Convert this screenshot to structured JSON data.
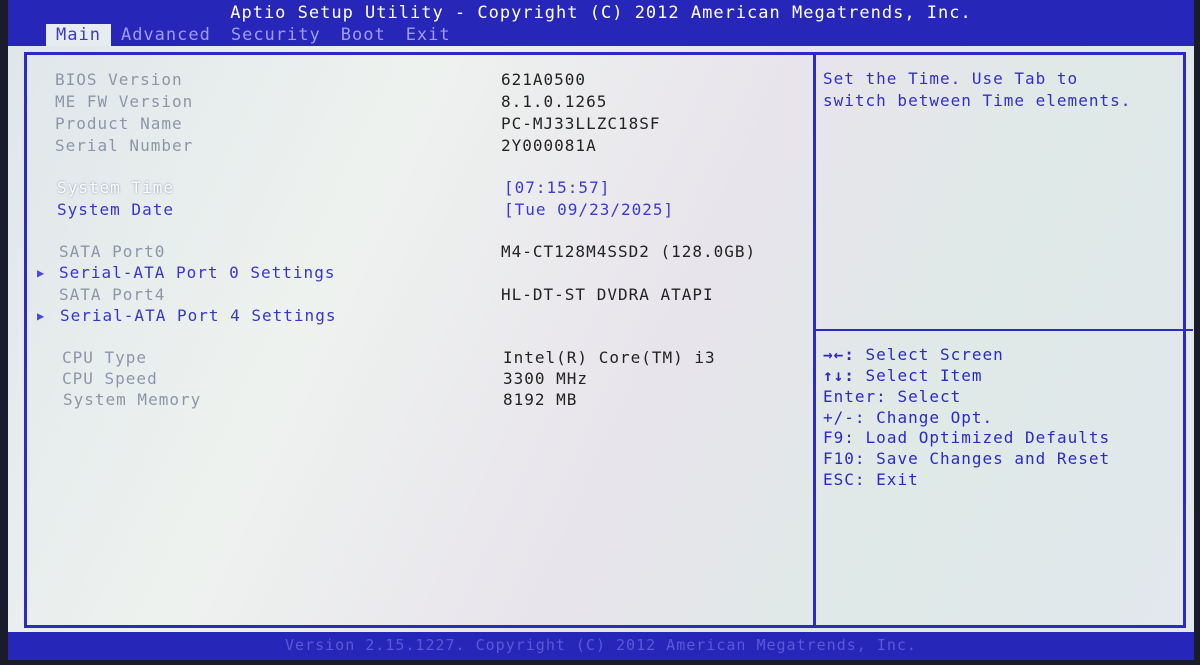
{
  "header": {
    "title": "Aptio Setup Utility - Copyright (C) 2012 American Megatrends, Inc.",
    "tabs": [
      {
        "label": "Main"
      },
      {
        "label": "Advanced"
      },
      {
        "label": "Security"
      },
      {
        "label": "Boot"
      },
      {
        "label": "Exit"
      }
    ]
  },
  "info": {
    "bios_version": {
      "label": "BIOS Version",
      "value": "621A0500"
    },
    "me_fw_version": {
      "label": "ME FW Version",
      "value": "8.1.0.1265"
    },
    "product_name": {
      "label": "Product Name",
      "value": "PC-MJ33LLZC18SF"
    },
    "serial_number": {
      "label": "Serial Number",
      "value": "2Y000081A"
    }
  },
  "time": {
    "system_time": {
      "label": "System Time",
      "value": "[07:15:57]"
    },
    "system_date": {
      "label": "System Date",
      "value": "[Tue 09/23/2025]"
    }
  },
  "storage": {
    "sata_port0": {
      "label": "SATA Port0",
      "value": "M4-CT128M4SSD2 (128.0GB)"
    },
    "port0_settings": {
      "label": "Serial-ATA Port 0 Settings"
    },
    "sata_port4": {
      "label": "SATA Port4",
      "value": "HL-DT-ST DVDRA ATAPI"
    },
    "port4_settings": {
      "label": "Serial-ATA Port 4 Settings"
    }
  },
  "cpu": {
    "cpu_type": {
      "label": "CPU Type",
      "value": "Intel(R) Core(TM) i3"
    },
    "cpu_speed": {
      "label": "CPU Speed",
      "value": "3300 MHz"
    },
    "system_memory": {
      "label": "System Memory",
      "value": "8192 MB"
    }
  },
  "help": {
    "line1": "Set the Time. Use Tab to",
    "line2": "switch between Time elements."
  },
  "keys": [
    {
      "key": "→←:",
      "desc": "Select Screen"
    },
    {
      "key": "↑↓:",
      "desc": "Select Item"
    },
    {
      "key": "Enter:",
      "desc": "Select"
    },
    {
      "key": "+/-:",
      "desc": "Change Opt."
    },
    {
      "key": "F9:",
      "desc": "Load Optimized Defaults"
    },
    {
      "key": "F10:",
      "desc": "Save Changes and Reset"
    },
    {
      "key": "ESC:",
      "desc": "Exit"
    }
  ],
  "footer": {
    "text": "Version 2.15.1227. Copyright (C) 2012 American Megatrends, Inc."
  }
}
